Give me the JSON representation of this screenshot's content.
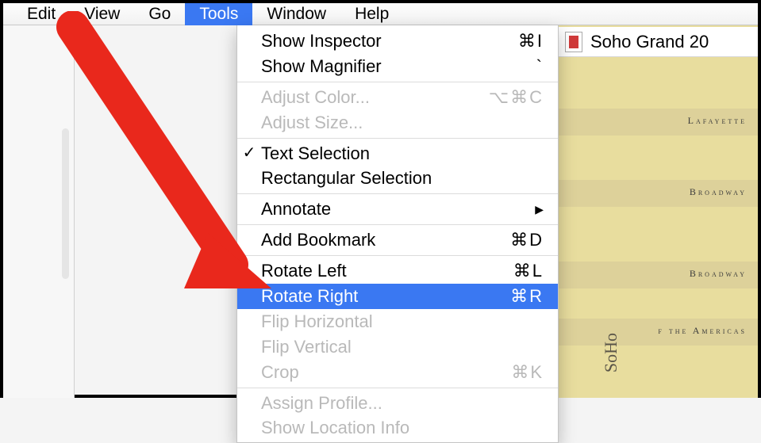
{
  "menubar": {
    "items": [
      {
        "label": "Edit",
        "open": false
      },
      {
        "label": "View",
        "open": false
      },
      {
        "label": "Go",
        "open": false
      },
      {
        "label": "Tools",
        "open": true
      },
      {
        "label": "Window",
        "open": false
      },
      {
        "label": "Help",
        "open": false
      }
    ]
  },
  "dropdown": {
    "items": [
      {
        "label": "Show Inspector",
        "shortcut": "⌘I",
        "disabled": false
      },
      {
        "label": "Show Magnifier",
        "shortcut": "`",
        "disabled": false
      },
      {
        "sep": true
      },
      {
        "label": "Adjust Color...",
        "shortcut": "⌥⌘C",
        "disabled": true
      },
      {
        "label": "Adjust Size...",
        "shortcut": "",
        "disabled": true
      },
      {
        "sep": true
      },
      {
        "label": "Text Selection",
        "shortcut": "",
        "check": true
      },
      {
        "label": "Rectangular Selection",
        "shortcut": ""
      },
      {
        "sep": true
      },
      {
        "label": "Annotate",
        "shortcut": "",
        "submenu": true
      },
      {
        "sep": true
      },
      {
        "label": "Add Bookmark",
        "shortcut": "⌘D"
      },
      {
        "sep": true
      },
      {
        "label": "Rotate Left",
        "shortcut": "⌘L"
      },
      {
        "label": "Rotate Right",
        "shortcut": "⌘R",
        "selected": true
      },
      {
        "label": "Flip Horizontal",
        "shortcut": "",
        "disabled": true
      },
      {
        "label": "Flip Vertical",
        "shortcut": "",
        "disabled": true
      },
      {
        "label": "Crop",
        "shortcut": "⌘K",
        "disabled": true
      },
      {
        "sep": true
      },
      {
        "label": "Assign Profile...",
        "shortcut": "",
        "disabled": true
      },
      {
        "label": "Show Location Info",
        "shortcut": "",
        "disabled": true
      }
    ]
  },
  "titletab": {
    "label": "Soho Grand 20"
  },
  "map": {
    "streets": [
      "Lafayette",
      "Broadway",
      "Broadway",
      "f the Americas"
    ],
    "label": "SoHo"
  },
  "colors": {
    "accent": "#3a78f2",
    "arrow": "#e9281c"
  }
}
